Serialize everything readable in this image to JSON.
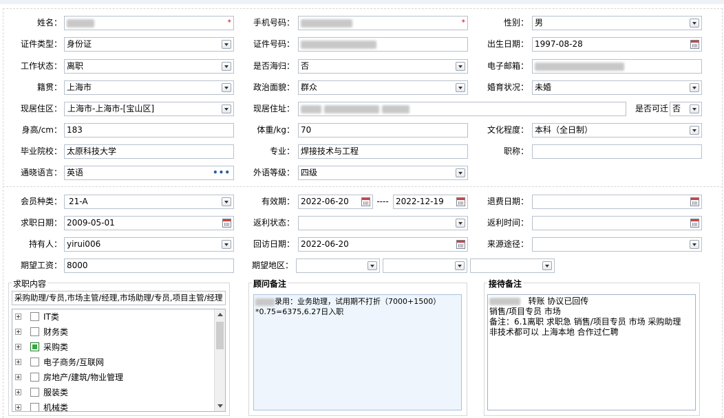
{
  "basic": {
    "name": {
      "label": "姓名："
    },
    "phone": {
      "label": "手机号码："
    },
    "gender": {
      "label": "性别：",
      "value": "男"
    },
    "id_type": {
      "label": "证件类型：",
      "value": "身份证"
    },
    "id_no": {
      "label": "证件号码："
    },
    "birth": {
      "label": "出生日期：",
      "value": "1997-08-28"
    },
    "work_status": {
      "label": "工作状态：",
      "value": "离职"
    },
    "overseas": {
      "label": "是否海归：",
      "value": "否"
    },
    "email": {
      "label": "电子邮箱："
    },
    "native": {
      "label": "籍贯：",
      "value": "上海市"
    },
    "politics": {
      "label": "政治面貌：",
      "value": "群众"
    },
    "marital": {
      "label": "婚育状况：",
      "value": "未婚"
    },
    "residence_area": {
      "label": "现居住区：",
      "value": "上海市-上海市-[宝山区]"
    },
    "address": {
      "label": "现居住址："
    },
    "relocate": {
      "label": "是否可迁",
      "value": "否"
    },
    "height": {
      "label": "身高/cm：",
      "value": "183"
    },
    "weight": {
      "label": "体重/kg：",
      "value": "70"
    },
    "education": {
      "label": "文化程度：",
      "value": "本科（全日制）"
    },
    "school": {
      "label": "毕业院校：",
      "value": "太原科技大学"
    },
    "major": {
      "label": "专业：",
      "value": "焊接技术与工程"
    },
    "title": {
      "label": "职称："
    },
    "language": {
      "label": "通晓语言：",
      "value": "英语",
      "more_glyph": "•••"
    },
    "lang_level": {
      "label": "外语等级：",
      "value": "四级"
    },
    "required_mark": "*"
  },
  "member": {
    "type": {
      "label": "会员种类：",
      "value": "21-A"
    },
    "validity": {
      "label": "有效期：",
      "from": "2022-06-20",
      "sep": "----",
      "to": "2022-12-19"
    },
    "refund_date": {
      "label": "退费日期："
    },
    "job_date": {
      "label": "求职日期：",
      "value": "2009-05-01"
    },
    "rebate_status": {
      "label": "返利状态："
    },
    "rebate_time": {
      "label": "返利时间："
    },
    "holder": {
      "label": "持有人：",
      "value": "yirui006"
    },
    "visit_date": {
      "label": "回访日期：",
      "value": "2022-06-20"
    },
    "source": {
      "label": "来源途径："
    },
    "salary": {
      "label": "期望工资：",
      "value": "8000"
    },
    "region": {
      "label": "期望地区："
    }
  },
  "job_content": {
    "title": "求职内容",
    "summary": "采购助理/专员,市场主管/经理,市场助理/专员,项目主管/经理",
    "tree": [
      {
        "label": "IT类",
        "checked": false
      },
      {
        "label": "财务类",
        "checked": false
      },
      {
        "label": "采购类",
        "checked": true
      },
      {
        "label": "电子商务/互联网",
        "checked": false
      },
      {
        "label": "房地产/建筑/物业管理",
        "checked": false
      },
      {
        "label": "服装类",
        "checked": false
      },
      {
        "label": "机械类",
        "checked": false
      }
    ]
  },
  "advisor_note": {
    "title": "顾问备注",
    "line1": "录用：业务助理，试用期不打折（7000+1500）",
    "line2": "*0.75=6375,6.27日入职"
  },
  "reception_note": {
    "title": "接待备注",
    "line1": "转账  协议已回传",
    "line2": "销售/项目专员 市场",
    "line3": "备注：6.1离职 求职急  销售/项目专员 市场 采购助理",
    "line4": "非技术都可以 上海本地 合作过仁聘"
  },
  "colors": {
    "required": "#dd0000",
    "checked": "#2eae3a",
    "note_bg": "#eef5fc",
    "border": "#b7c0cb"
  }
}
